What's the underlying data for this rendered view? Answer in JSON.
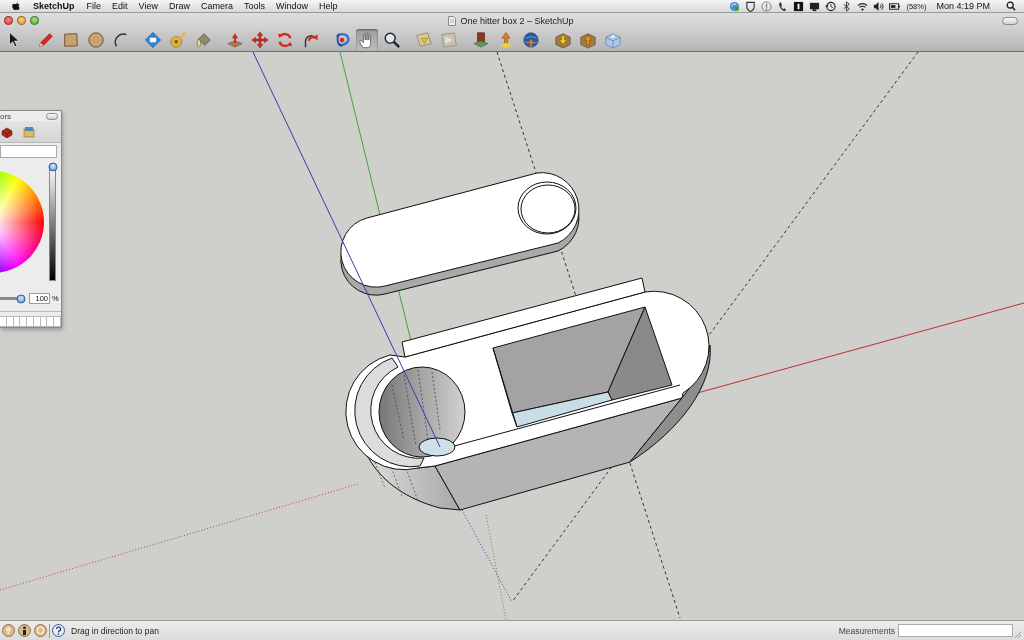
{
  "menu_bar": {
    "app_name": "SketchUp",
    "menus": [
      "File",
      "Edit",
      "View",
      "Draw",
      "Camera",
      "Tools",
      "Window",
      "Help"
    ],
    "battery_percent": "(58%)",
    "clock": "Mon 4:19 PM"
  },
  "window": {
    "title": "One hitter box 2 – SketchUp"
  },
  "toolbar": {
    "groups": [
      {
        "tools": [
          {
            "kind": "select",
            "selected": false
          }
        ]
      },
      {
        "tools": [
          {
            "kind": "pencil",
            "selected": false
          },
          {
            "kind": "rectangle",
            "selected": false
          },
          {
            "kind": "circle",
            "selected": false
          },
          {
            "kind": "arc",
            "selected": false
          }
        ]
      },
      {
        "tools": [
          {
            "kind": "component",
            "selected": false
          },
          {
            "kind": "tape",
            "selected": false
          },
          {
            "kind": "paint",
            "selected": false
          }
        ]
      },
      {
        "tools": [
          {
            "kind": "pushpull",
            "selected": false
          },
          {
            "kind": "move",
            "selected": false
          },
          {
            "kind": "rotate",
            "selected": false
          },
          {
            "kind": "followme",
            "selected": false
          }
        ]
      },
      {
        "tools": [
          {
            "kind": "orbit",
            "selected": false
          },
          {
            "kind": "pan",
            "selected": true
          },
          {
            "kind": "zoom",
            "selected": false
          }
        ]
      },
      {
        "tools": [
          {
            "kind": "photo",
            "selected": false
          },
          {
            "kind": "terrain",
            "selected": false
          }
        ]
      },
      {
        "tools": [
          {
            "kind": "building",
            "selected": false
          },
          {
            "kind": "pin",
            "selected": false
          },
          {
            "kind": "globe",
            "selected": false
          }
        ]
      },
      {
        "tools": [
          {
            "kind": "download",
            "selected": false
          },
          {
            "kind": "upload",
            "selected": false
          },
          {
            "kind": "share",
            "selected": false
          }
        ]
      }
    ]
  },
  "colors_panel": {
    "title": "ors",
    "brightness": {
      "level": 1
    },
    "opacity": {
      "level": 1
    },
    "opacity_value": "100",
    "opacity_unit": "%"
  },
  "status_bar": {
    "hint": "Drag in direction to pan",
    "measurements_label": "Measurements"
  }
}
